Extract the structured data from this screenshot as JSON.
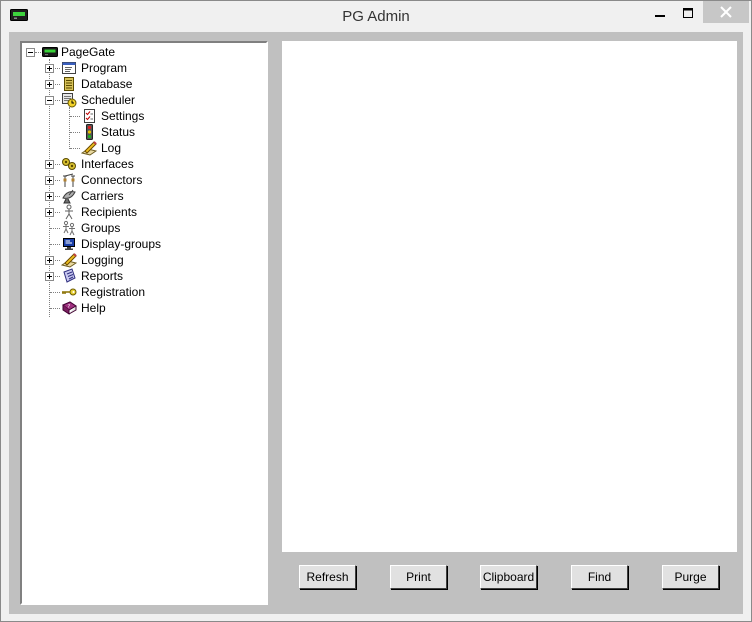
{
  "window": {
    "title": "PG Admin",
    "app_icon": "pager-icon",
    "controls": {
      "minimize": "minimize-icon",
      "maximize": "maximize-icon",
      "close": "close-icon"
    }
  },
  "tree": {
    "root": {
      "label": "PageGate",
      "icon": "pager-icon",
      "expanded": true
    },
    "items": [
      {
        "label": "Program",
        "icon": "window-icon",
        "expander": "plus"
      },
      {
        "label": "Database",
        "icon": "database-icon",
        "expander": "plus"
      },
      {
        "label": "Scheduler",
        "icon": "scheduler-icon",
        "expander": "minus",
        "children": [
          {
            "label": "Settings",
            "icon": "checklist-icon"
          },
          {
            "label": "Status",
            "icon": "traffic-light-icon"
          },
          {
            "label": "Log",
            "icon": "log-pencil-icon"
          }
        ]
      },
      {
        "label": "Interfaces",
        "icon": "interfaces-icon",
        "expander": "plus"
      },
      {
        "label": "Connectors",
        "icon": "connectors-icon",
        "expander": "plus"
      },
      {
        "label": "Carriers",
        "icon": "satellite-icon",
        "expander": "plus"
      },
      {
        "label": "Recipients",
        "icon": "person-icon",
        "expander": "plus"
      },
      {
        "label": "Groups",
        "icon": "people-icon",
        "expander": "none"
      },
      {
        "label": "Display-groups",
        "icon": "monitor-icon",
        "expander": "none"
      },
      {
        "label": "Logging",
        "icon": "logging-icon",
        "expander": "plus"
      },
      {
        "label": "Reports",
        "icon": "reports-icon",
        "expander": "plus"
      },
      {
        "label": "Registration",
        "icon": "key-icon",
        "expander": "none"
      },
      {
        "label": "Help",
        "icon": "help-book-icon",
        "expander": "none"
      }
    ]
  },
  "buttons": {
    "refresh": "Refresh",
    "print": "Print",
    "clipboard": "Clipboard",
    "find": "Find",
    "purge": "Purge"
  },
  "colors": {
    "client_background": "#c0c0c0",
    "panel_background": "#ffffff",
    "button_face": "#e1e1e1"
  }
}
